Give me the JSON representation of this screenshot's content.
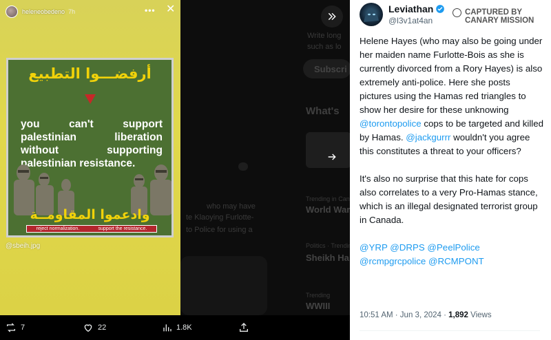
{
  "story": {
    "handle": "heleneobedeno",
    "time": "7h",
    "more_icon": "more-dots-icon",
    "close_icon": "close-icon",
    "poster": {
      "arabic_top": "أرفضـــوا التطبيع",
      "slogan": "you can't support palestinian liberation without supporting palestinian resistance.",
      "arabic_bottom": "وادعموا المقاومــة",
      "banner_left": "reject normalization.",
      "banner_right": "support the resistance."
    },
    "credit": "@sbeih.jpg"
  },
  "actions": {
    "retweet_count": "7",
    "like_count": "22",
    "views_count": "1.8K",
    "icons": [
      "retweet-icon",
      "heart-icon",
      "views-icon",
      "share-icon"
    ]
  },
  "background": {
    "write_long": "Write long",
    "such_as": "such as lo",
    "subscribe": "Subscri",
    "whats": "What's",
    "post_snippet_1": "who may have",
    "post_snippet_2": "te Klaoying Furlotte-",
    "post_snippet_3": "to Police for using a",
    "item_1_cat": "Trending in Canada",
    "item_1_title": "World War",
    "item_2_cat": "Politics · Trending",
    "item_2_title": "Sheikh Ha",
    "item_3_cat": "Trending",
    "item_3_title": "WWIII"
  },
  "tweet": {
    "name": "Leviathan",
    "handle": "@l3v1at4an",
    "verified_icon": "verified-badge-icon",
    "badge_line1": "CAPTURED BY",
    "badge_line2": "CANARY MISSION",
    "para1_a": "Helene Hayes (who may also be going under her maiden name Furlotte-Bois as she is currently divorced from a Rory Hayes) is also extremely anti-police. Here she posts pictures using the Hamas red triangles to show her desire for these unknowing ",
    "para1_link1": "@torontopolice",
    "para1_b": " cops to be targeted and killed by Hamas. ",
    "para1_link2": "@jackgurrr",
    "para1_c": " wouldn't you agree this constitutes a threat to your officers?",
    "para2": "It's also no surprise that this hate for cops also correlates to a very Pro-Hamas stance, which is an illegal designated terrorist group in Canada.",
    "mentions": "@YRP @DRPS @PeelPolice @rcmpgrcpolice @RCMPONT",
    "time": "10:51 AM · Jun 3, 2024 · ",
    "views": "1,892",
    "views_label": " Views"
  },
  "colors": {
    "link": "#1d9bf0",
    "poster_green": "#4c7032",
    "poster_yellow": "#f1d20a",
    "triangle_red": "#c62828",
    "story_bg": "#dcd246"
  }
}
